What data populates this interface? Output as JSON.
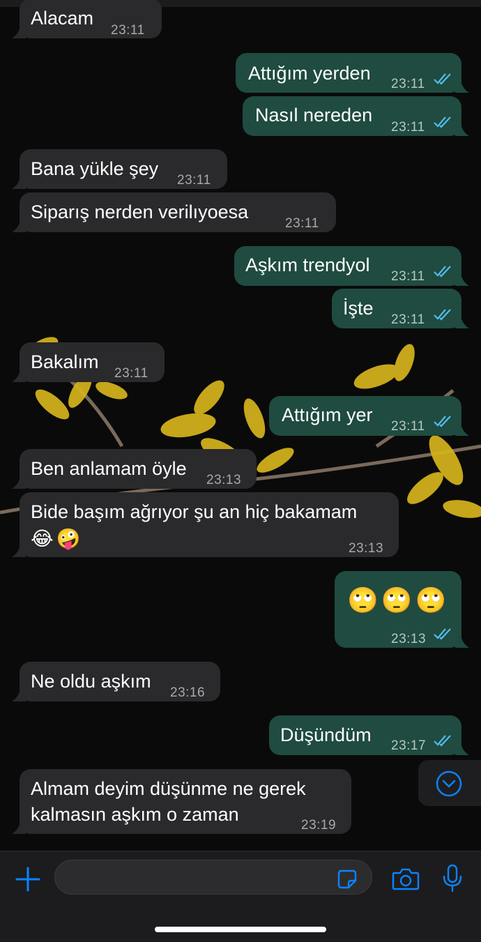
{
  "chat": {
    "messages": [
      {
        "dir": "in",
        "text": "Alacam",
        "time": "23:11"
      },
      {
        "dir": "out",
        "text": "Attığım yerden",
        "time": "23:11"
      },
      {
        "dir": "out",
        "text": "Nasıl nereden",
        "time": "23:11"
      },
      {
        "dir": "in",
        "text": "Bana yükle şey",
        "time": "23:11"
      },
      {
        "dir": "in",
        "text": "Siparış nerden verilıyoesa",
        "time": "23:11"
      },
      {
        "dir": "out",
        "text": "Aşkım trendyol",
        "time": "23:11"
      },
      {
        "dir": "out",
        "text": "İşte",
        "time": "23:11"
      },
      {
        "dir": "in",
        "text": "Bakalım",
        "time": "23:11"
      },
      {
        "dir": "out",
        "text": "Attığım yer",
        "time": "23:11"
      },
      {
        "dir": "in",
        "text": "Ben anlamam öyle",
        "time": "23:13"
      },
      {
        "dir": "in",
        "text": "Bide başım ağrıyor şu an hiç bakamam",
        "emojis": [
          "😂",
          "🤪"
        ],
        "time": "23:13"
      },
      {
        "dir": "out",
        "text": "",
        "emojis": [
          "🙄",
          "🙄",
          "🙄"
        ],
        "time": "23:13"
      },
      {
        "dir": "in",
        "text": "Ne oldu aşkım",
        "time": "23:16"
      },
      {
        "dir": "out",
        "text": "Düşündüm",
        "time": "23:17"
      },
      {
        "dir": "in",
        "text": "Almam deyim düşünme ne gerek kalmasın aşkım o zaman",
        "time": "23:19"
      }
    ]
  },
  "icons": {
    "read_receipt": "double-check-icon",
    "scroll_down": "chevron-down-circle-icon",
    "attach": "plus-icon",
    "sticker": "sticker-icon",
    "camera": "camera-icon",
    "mic": "microphone-icon"
  },
  "colors": {
    "incoming_bubble": "#2a2a2c",
    "outgoing_bubble": "#1f4b40",
    "accent": "#0a84ff",
    "read_tick": "#53bdeb"
  }
}
